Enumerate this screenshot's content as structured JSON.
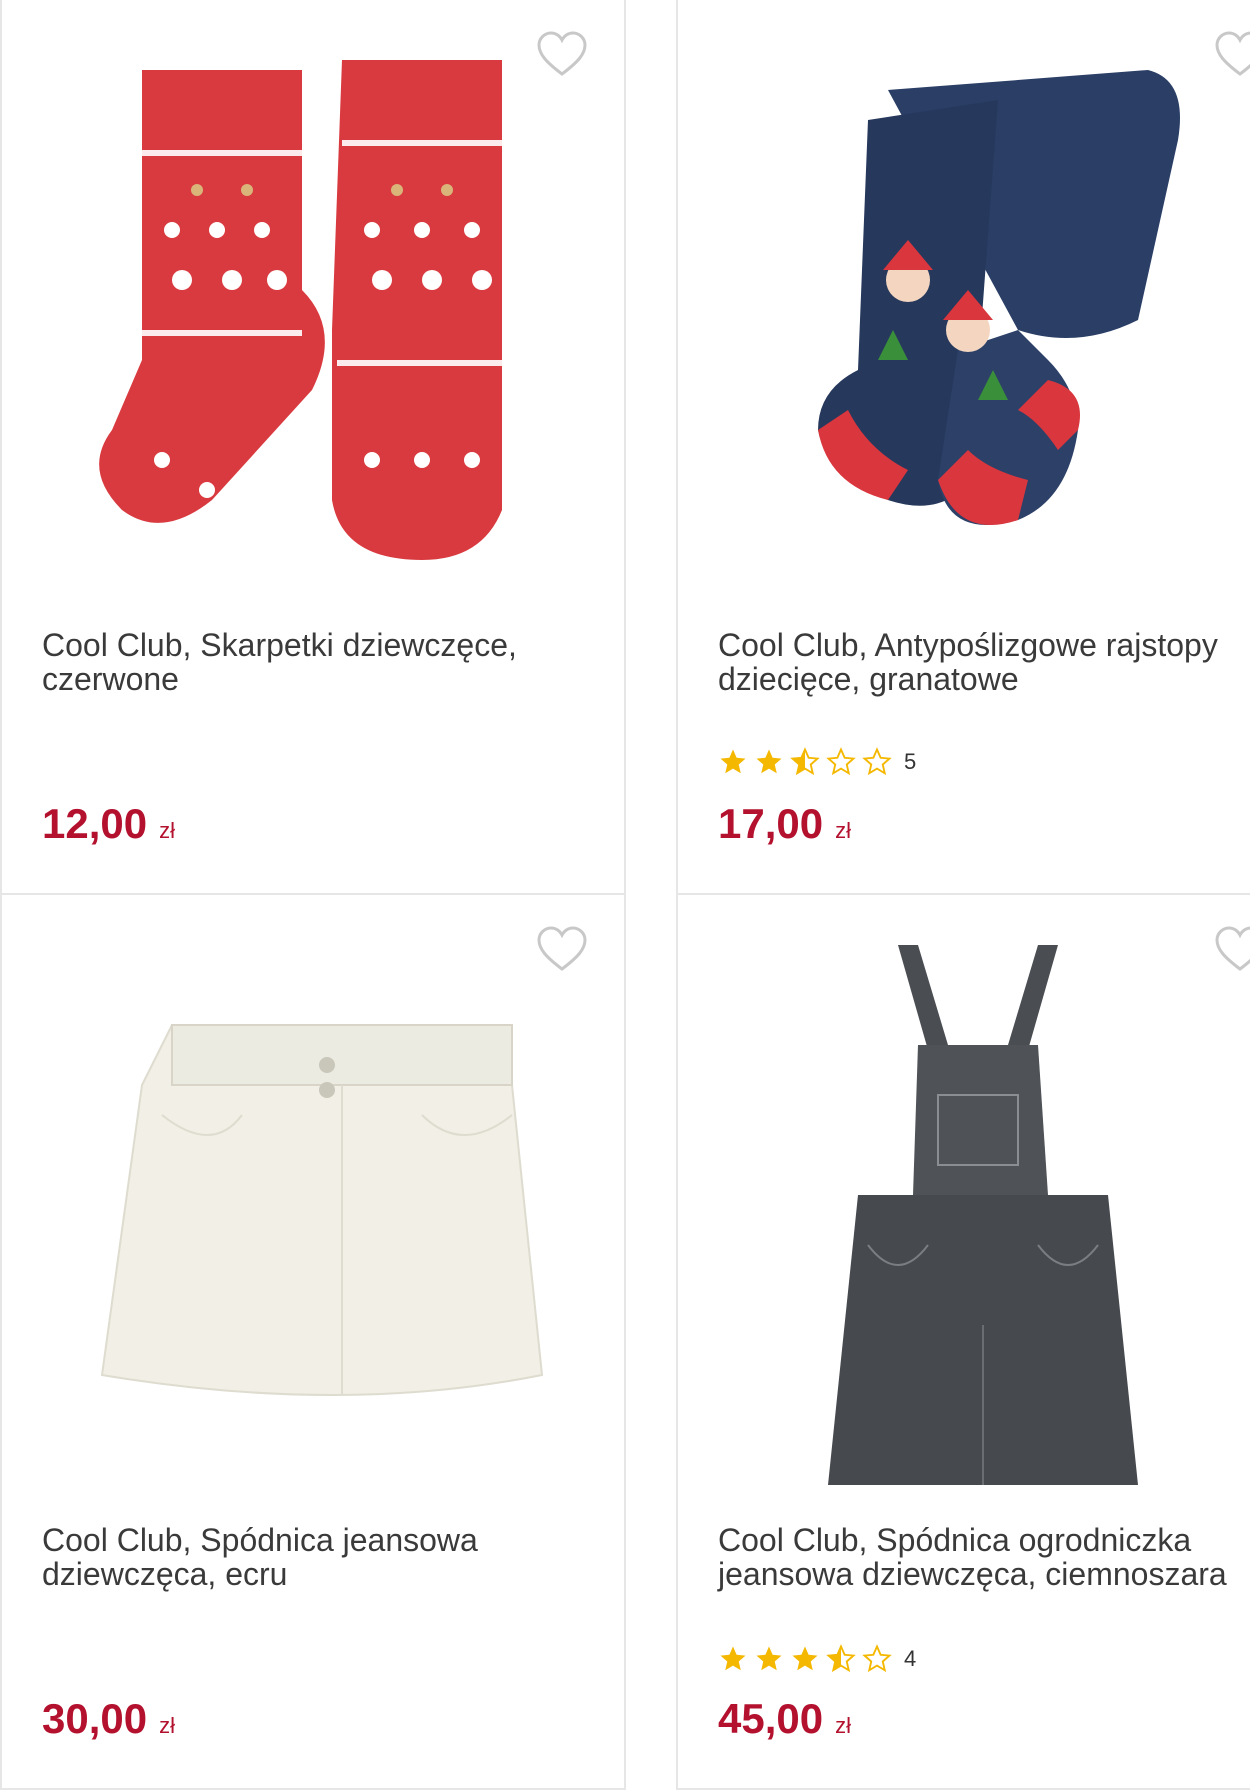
{
  "products": [
    {
      "title": "Cool Club, Skarpetki dziewczęce, czerwone",
      "price": "12,00",
      "currency": "zł",
      "image_desc": "red-christmas-socks"
    },
    {
      "title": "Cool Club, Antypoślizgowe rajstopy dziecięce, granatowe",
      "price": "17,00",
      "currency": "zł",
      "rating": 2.5,
      "rating_max": 5,
      "rating_count": "5",
      "image_desc": "navy-santa-tights"
    },
    {
      "title": "Cool Club, Spódnica jeansowa dziewczęca, ecru",
      "price": "30,00",
      "currency": "zł",
      "image_desc": "ecru-denim-skirt"
    },
    {
      "title": "Cool Club, Spódnica ogrodniczka jeansowa dziewczęca, ciemnoszara",
      "price": "45,00",
      "currency": "zł",
      "rating": 3.5,
      "rating_max": 5,
      "rating_count": "4",
      "image_desc": "dark-grey-denim-dungaree-dress"
    }
  ],
  "colors": {
    "price": "#b3112e",
    "star": "#f5b800",
    "border": "#e6e6e6"
  }
}
